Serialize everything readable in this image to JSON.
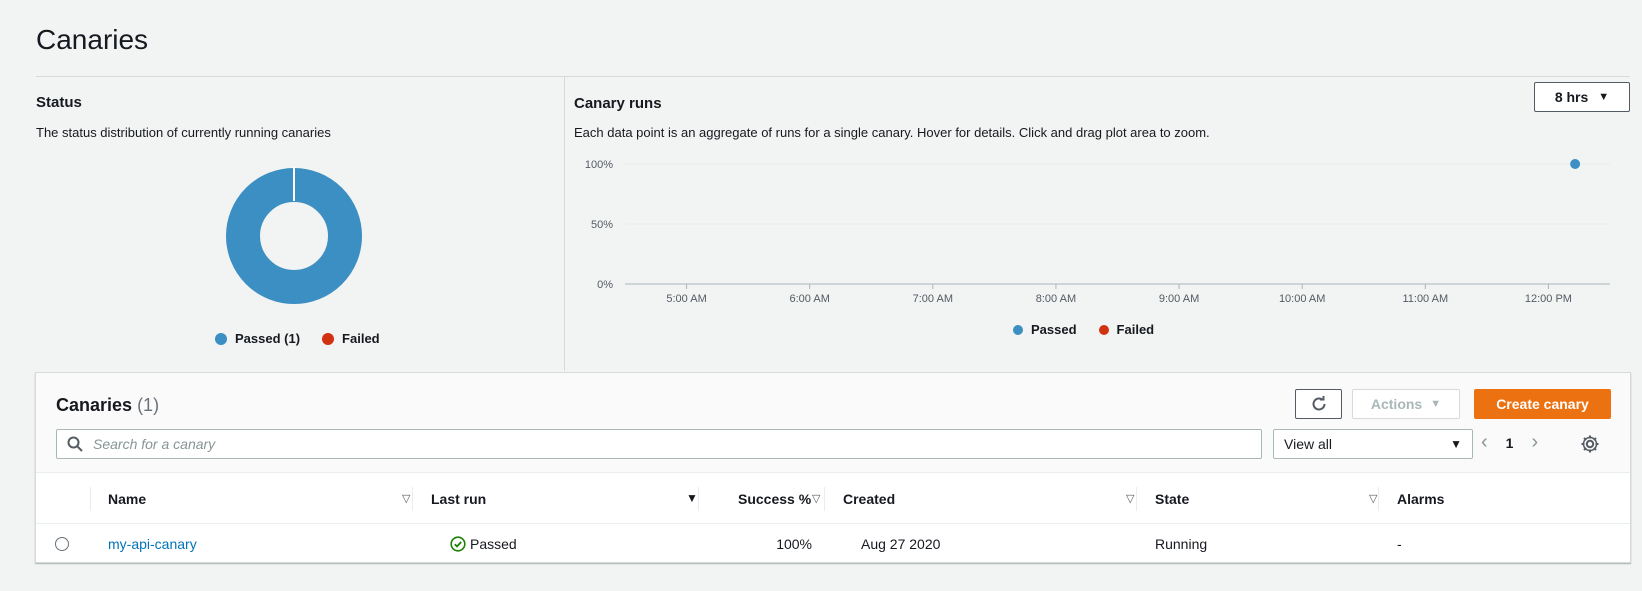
{
  "page": {
    "title": "Canaries"
  },
  "status": {
    "title": "Status",
    "description": "The status distribution of currently running canaries",
    "legend": [
      {
        "label": "Passed (1)",
        "color": "#3b8fc2"
      },
      {
        "label": "Failed",
        "color": "#d13212"
      }
    ],
    "distribution": {
      "passed": 1,
      "failed": 0
    }
  },
  "runs": {
    "title": "Canary runs",
    "description": "Each data point is an aggregate of runs for a single canary. Hover for details. Click and drag plot area to zoom.",
    "range": "8 hrs",
    "legend": [
      {
        "label": "Passed",
        "color": "#3b8fc2"
      },
      {
        "label": "Failed",
        "color": "#d13212"
      }
    ]
  },
  "chart_data": {
    "type": "scatter",
    "y_ticks": [
      "100%",
      "50%",
      "0%"
    ],
    "x_ticks": [
      "5:00 AM",
      "6:00 AM",
      "7:00 AM",
      "8:00 AM",
      "9:00 AM",
      "10:00 AM",
      "11:00 AM",
      "12:00 PM"
    ],
    "ylim": [
      0,
      100
    ],
    "xlim": [
      "4:30 AM",
      "12:30 PM"
    ],
    "grid": true,
    "legend_position": "bottom",
    "series": [
      {
        "name": "Passed",
        "color": "#3b8fc2",
        "points": [
          {
            "x": "12:13 PM",
            "y": 100
          }
        ]
      },
      {
        "name": "Failed",
        "color": "#d13212",
        "points": []
      }
    ]
  },
  "table": {
    "title": "Canaries",
    "count": "(1)",
    "actions_label": "Actions",
    "create_label": "Create canary",
    "search_placeholder": "Search for a canary",
    "filter_value": "View all",
    "page": "1",
    "columns": [
      "Name",
      "Last run",
      "Success %",
      "Created",
      "State",
      "Alarms"
    ],
    "rows": [
      {
        "name": "my-api-canary",
        "last_run": "Passed",
        "success": "100%",
        "created": "Aug 27 2020",
        "state": "Running",
        "alarms": "-"
      }
    ]
  },
  "colors": {
    "accent": "#ec7211",
    "link": "#0073bb",
    "passed": "#3b8fc2",
    "failed": "#d13212",
    "ok": "#1d8102"
  }
}
